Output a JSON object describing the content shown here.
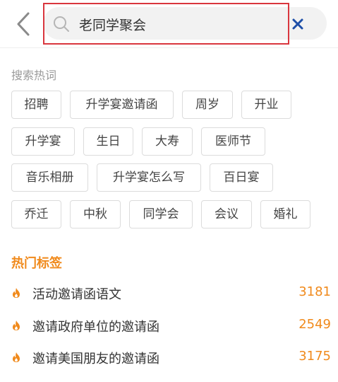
{
  "search": {
    "query": "老同学聚会"
  },
  "hot_search": {
    "title": "搜索热词",
    "tags": [
      "招聘",
      "升学宴邀请函",
      "周岁",
      "开业",
      "升学宴",
      "生日",
      "大寿",
      "医师节",
      "音乐相册",
      "升学宴怎么写",
      "百日宴",
      "乔迁",
      "中秋",
      "同学会",
      "会议",
      "婚礼"
    ]
  },
  "hot_tags": {
    "title": "热门标签",
    "items": [
      {
        "label": "活动邀请函语文",
        "count": "3181"
      },
      {
        "label": "邀请政府单位的邀请函",
        "count": "2549"
      },
      {
        "label": "邀请美国朋友的邀请函",
        "count": "3175"
      }
    ]
  },
  "colors": {
    "accent": "#f08a1c",
    "highlight_border": "#d9363e",
    "clear_icon": "#1d4fa8"
  },
  "icons": [
    "back-chevron-icon",
    "search-icon",
    "clear-x-icon",
    "fire-icon"
  ]
}
